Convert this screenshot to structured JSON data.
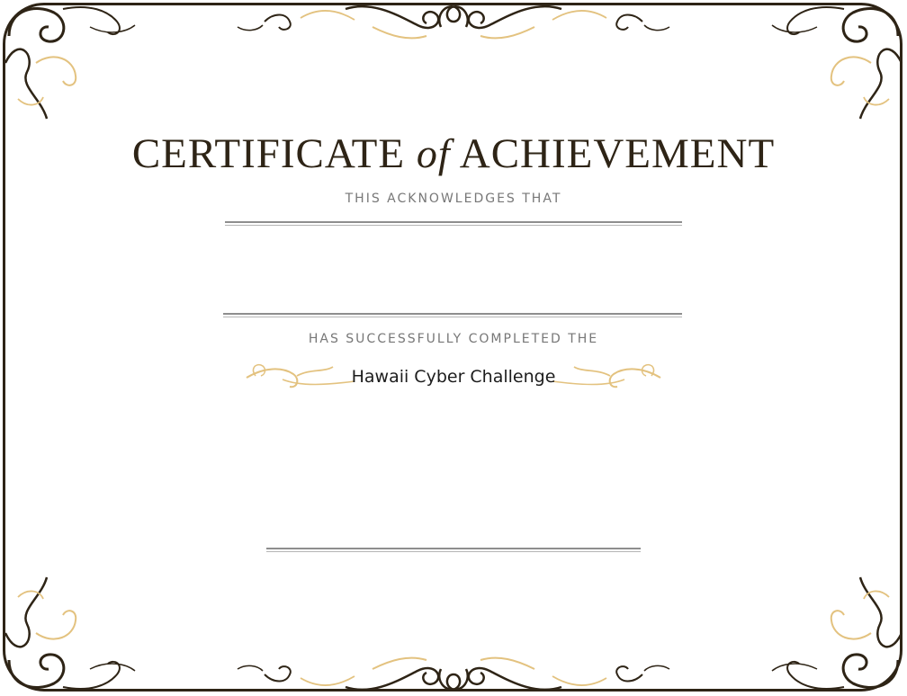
{
  "certificate": {
    "title_main": "CERTIFICATE",
    "title_of": "of",
    "title_end": "ACHIEVEMENT",
    "acknowledges": "THIS ACKNOWLEDGES THAT",
    "completed": "HAS SUCCESSFULLY COMPLETED THE",
    "program": "Hawaii Cyber Challenge"
  },
  "colors": {
    "ink": "#2e2416",
    "gold": "#e3c27f",
    "rule": "#8e8e8e"
  }
}
